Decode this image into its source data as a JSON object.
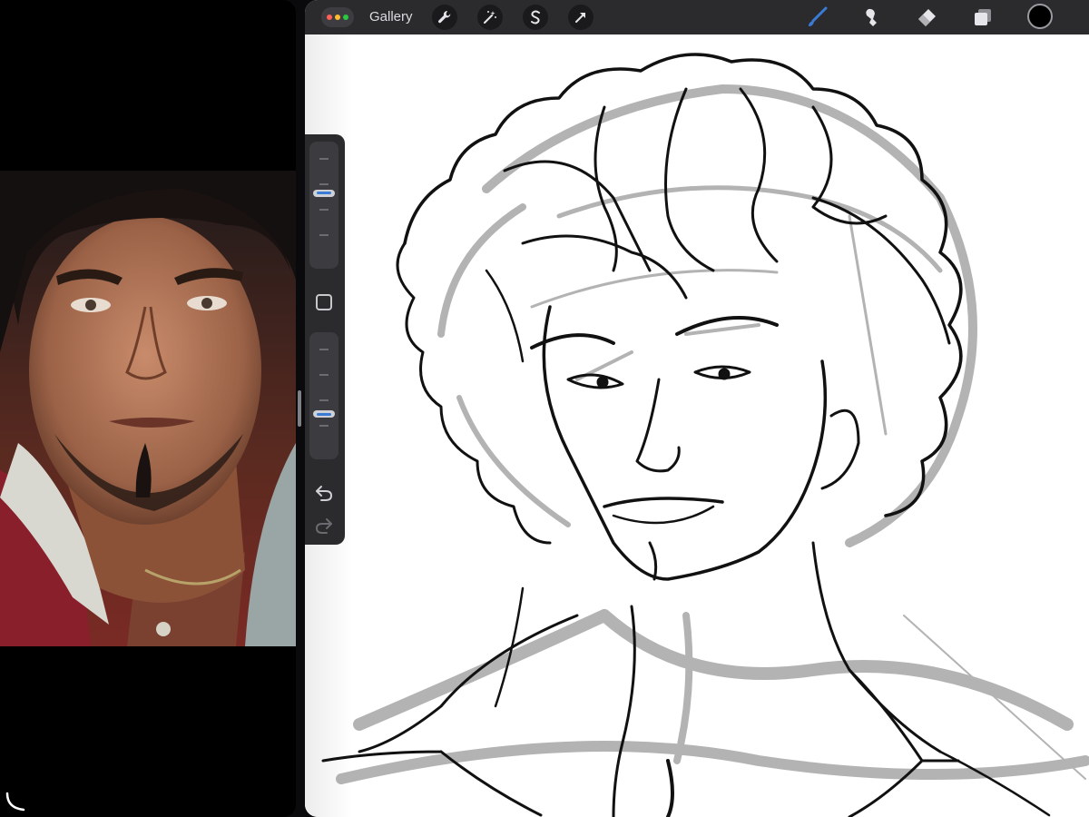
{
  "toolbar": {
    "gallery_label": "Gallery",
    "window_dots": [
      "#ff5f57",
      "#febc2e",
      "#28c840"
    ],
    "left_tools": [
      "wrench-icon",
      "magic-wand-icon",
      "selection-s-icon",
      "transform-arrow-icon"
    ],
    "right_tools": [
      "brush-icon",
      "smudge-icon",
      "eraser-icon",
      "layers-icon"
    ],
    "active_tool": "brush-icon",
    "active_color": "#000000",
    "accent_color": "#3a7bd5"
  },
  "sidebar": {
    "brush_size_level": 0.62,
    "opacity_level": 0.32,
    "modify_icon": "square-icon",
    "undo_icon": "undo-arrow-icon",
    "redo_icon": "redo-arrow-icon"
  },
  "reference": {
    "subject": "portrait-photo",
    "shirt_color": "#8a1f2c"
  }
}
